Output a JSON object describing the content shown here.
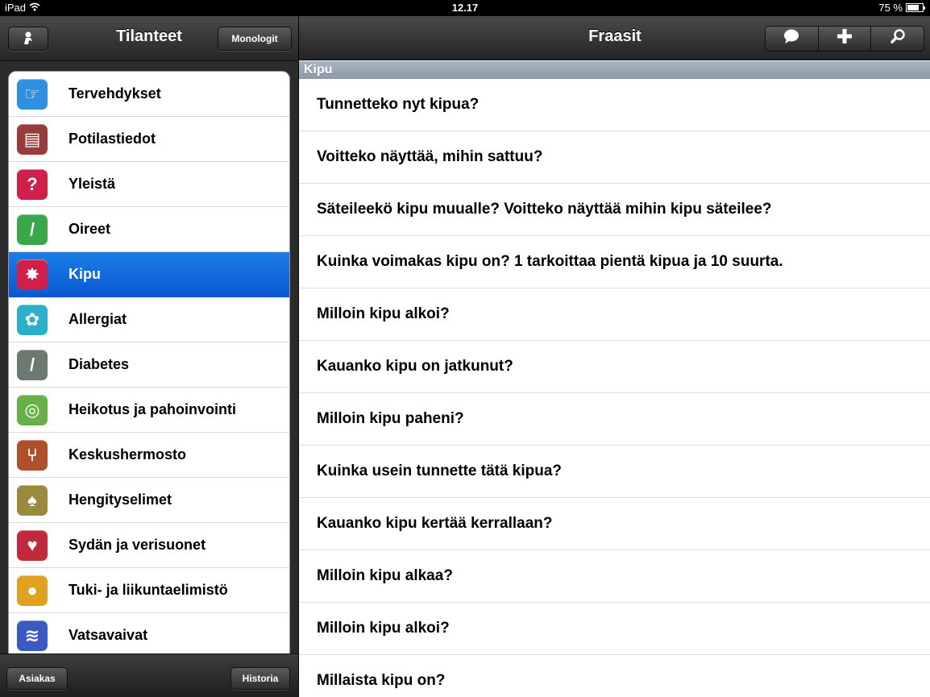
{
  "status_bar": {
    "device": "iPad",
    "time": "12.17",
    "battery": "75 %",
    "battery_fraction": 0.75
  },
  "left": {
    "title": "Tilanteet",
    "monologit_label": "Monologit",
    "items": [
      {
        "label": "Tervehdykset",
        "icon": "hand-icon",
        "color": "#2f8fe0",
        "glyph": "☞"
      },
      {
        "label": "Potilastiedot",
        "icon": "book-icon",
        "color": "#9a3b3b",
        "glyph": "▤"
      },
      {
        "label": "Yleistä",
        "icon": "question-icon",
        "color": "#d0204a",
        "glyph": "?"
      },
      {
        "label": "Oireet",
        "icon": "pen-icon",
        "color": "#3aa84a",
        "glyph": "/"
      },
      {
        "label": "Kipu",
        "icon": "burst-icon",
        "color": "#d0204a",
        "glyph": "✸"
      },
      {
        "label": "Allergiat",
        "icon": "flower-icon",
        "color": "#2ab0c8",
        "glyph": "✿"
      },
      {
        "label": "Diabetes",
        "icon": "syringe-icon",
        "color": "#6a7a70",
        "glyph": "/"
      },
      {
        "label": "Heikotus ja pahoinvointi",
        "icon": "spiral-icon",
        "color": "#6ab04a",
        "glyph": "◎"
      },
      {
        "label": "Keskushermosto",
        "icon": "nerve-icon",
        "color": "#b0502a",
        "glyph": "⑂"
      },
      {
        "label": "Hengityselimet",
        "icon": "lungs-icon",
        "color": "#9a8a40",
        "glyph": "♠"
      },
      {
        "label": "Sydän ja verisuonet",
        "icon": "heart-icon",
        "color": "#c02a3a",
        "glyph": "♥"
      },
      {
        "label": "Tuki- ja liikuntaelimistö",
        "icon": "body-icon",
        "color": "#e0a020",
        "glyph": "●"
      },
      {
        "label": "Vatsavaivat",
        "icon": "waves-icon",
        "color": "#3a5ac0",
        "glyph": "≋"
      }
    ],
    "selected_index": 4,
    "asiakas_label": "Asiakas",
    "historia_label": "Historia"
  },
  "right": {
    "title": "Fraasit",
    "section": "Kipu",
    "phrases": [
      "Tunnetteko nyt kipua?",
      "Voitteko näyttää, mihin sattuu?",
      "Säteileekö kipu muualle? Voitteko näyttää mihin kipu säteilee?",
      "Kuinka voimakas kipu on? 1 tarkoittaa pientä kipua ja 10 suurta.",
      "Milloin kipu alkoi?",
      "Kauanko kipu on jatkunut?",
      "Milloin kipu paheni?",
      "Kuinka usein tunnette tätä kipua?",
      "Kauanko kipu kertää kerrallaan?",
      "Milloin kipu alkaa?",
      "Milloin kipu alkoi?",
      "Millaista kipu on?"
    ]
  }
}
